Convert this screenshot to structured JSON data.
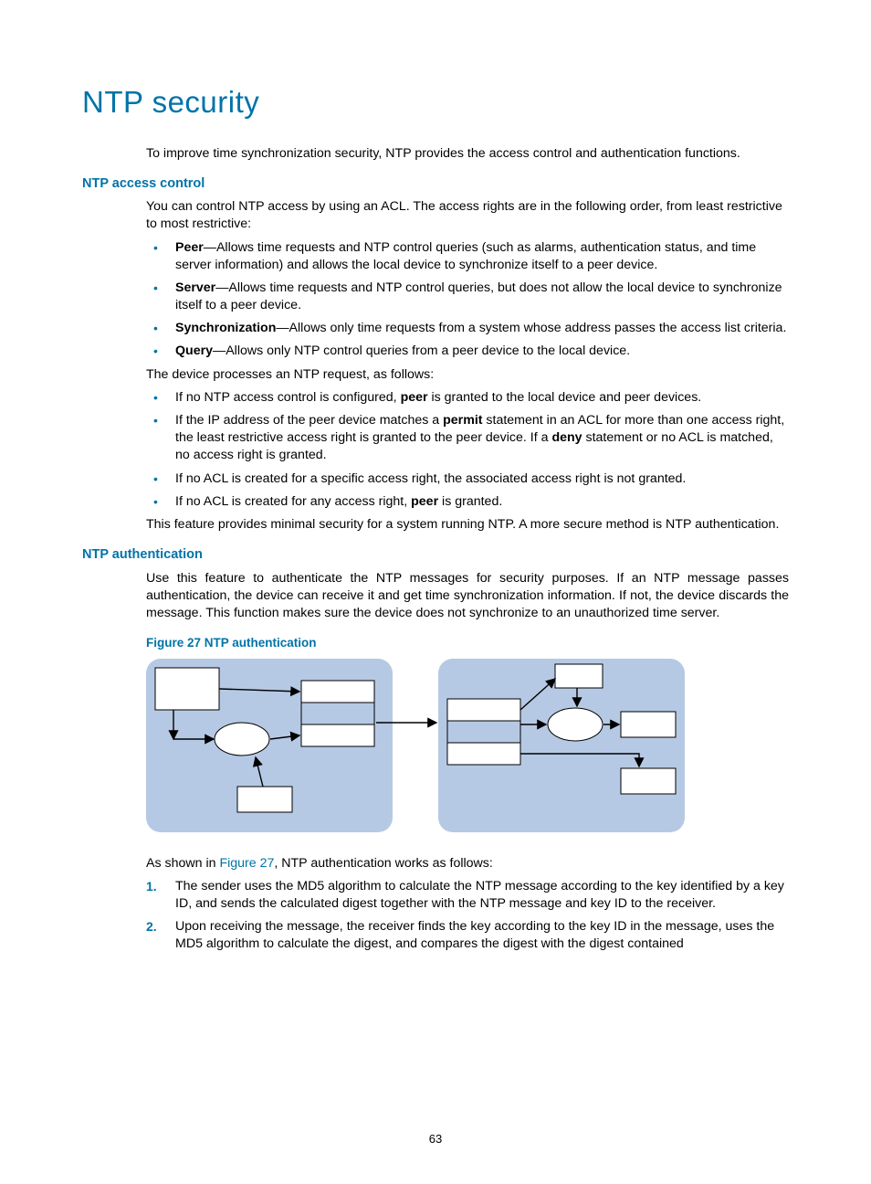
{
  "title": "NTP security",
  "intro": "To improve time synchronization security, NTP provides the access control and authentication functions.",
  "access": {
    "heading": "NTP access control",
    "intro": "You can control NTP access by using an ACL. The access rights are in the following order, from least restrictive to most restrictive:",
    "items": [
      {
        "term": "Peer",
        "text": "—Allows time requests and NTP control queries (such as alarms, authentication status, and time server information) and allows the local device to synchronize itself to a peer device."
      },
      {
        "term": "Server",
        "text": "—Allows time requests and NTP control queries, but does not allow the local device to synchronize itself to a peer device."
      },
      {
        "term": "Synchronization",
        "text": "—Allows only time requests from a system whose address passes the access list criteria."
      },
      {
        "term": "Query",
        "text": "—Allows only NTP control queries from a peer device to the local device."
      }
    ],
    "process_lead": "The device processes an NTP request, as follows:",
    "process": [
      {
        "pre": "If no NTP access control is configured, ",
        "b1": "peer",
        "post": " is granted to the local device and peer devices."
      },
      {
        "pre": "If the IP address of the peer device matches a ",
        "b1": "permit",
        "mid": " statement in an ACL for more than one access right, the least restrictive access right is granted to the peer device. If a ",
        "b2": "deny",
        "post": " statement or no ACL is matched, no access right is granted."
      },
      {
        "pre": "If no ACL is created for a specific access right, the associated access right is not granted.",
        "b1": "",
        "post": ""
      },
      {
        "pre": "If no ACL is created for any access right, ",
        "b1": "peer",
        "post": " is granted."
      }
    ],
    "note": "This feature provides minimal security for a system running NTP. A more secure method is NTP authentication."
  },
  "auth": {
    "heading": "NTP authentication",
    "para": "Use this feature to authenticate the NTP messages for security purposes. If an NTP message passes authentication, the device can receive it and get time synchronization information. If not, the device discards the message. This function makes sure the device does not synchronize to an unauthorized time server.",
    "figcap": "Figure 27 NTP authentication",
    "shown_pre": "As shown in ",
    "shown_ref": "Figure 27",
    "shown_post": ", NTP authentication works as follows:",
    "steps": [
      "The sender uses the MD5 algorithm to calculate the NTP message according to the key identified by a key ID, and sends the calculated digest together with the NTP message and key ID to the receiver.",
      "Upon receiving the message, the receiver finds the key according to the key ID in the message, uses the MD5 algorithm to calculate the digest, and compares the digest with the digest contained"
    ]
  },
  "page_number": "63"
}
